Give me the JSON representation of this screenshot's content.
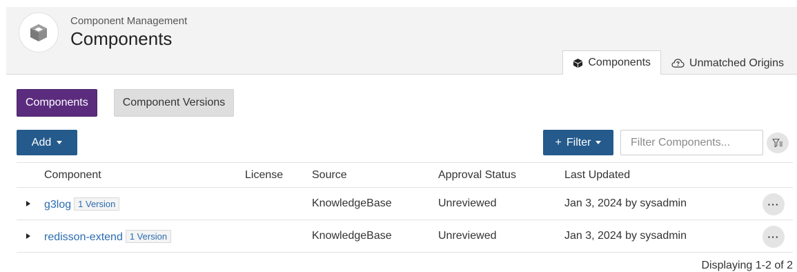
{
  "header": {
    "breadcrumb": "Component Management",
    "title": "Components",
    "logo_icon": "cube-icon",
    "tabs": [
      {
        "label": "Components",
        "icon": "cube-icon",
        "active": true
      },
      {
        "label": "Unmatched Origins",
        "icon": "cloud-question-icon",
        "active": false
      }
    ]
  },
  "view_toggle": {
    "components_label": "Components",
    "versions_label": "Component Versions"
  },
  "toolbar": {
    "add_label": "Add",
    "filter_label": "Filter",
    "filter_prefix": "+",
    "filter_placeholder": "Filter Components...",
    "clear_filter_icon": "filter-clear-icon"
  },
  "table": {
    "columns": {
      "component": "Component",
      "license": "License",
      "source": "Source",
      "approval_status": "Approval Status",
      "last_updated": "Last Updated"
    },
    "rows": [
      {
        "name": "g3log",
        "versions": "1 Version",
        "license": "",
        "source": "KnowledgeBase",
        "approval_status": "Unreviewed",
        "last_updated": "Jan 3, 2024 by sysadmin",
        "actions": "···"
      },
      {
        "name": "redisson-extend",
        "versions": "1 Version",
        "license": "",
        "source": "KnowledgeBase",
        "approval_status": "Unreviewed",
        "last_updated": "Jan 3, 2024 by sysadmin",
        "actions": "···"
      }
    ]
  },
  "footer": {
    "count_text": "Displaying 1-2 of 2"
  },
  "colors": {
    "primary_button": "#245a8c",
    "active_toggle": "#5b2c7e",
    "link": "#2b6cb0",
    "header_bg": "#f3f3f3"
  }
}
